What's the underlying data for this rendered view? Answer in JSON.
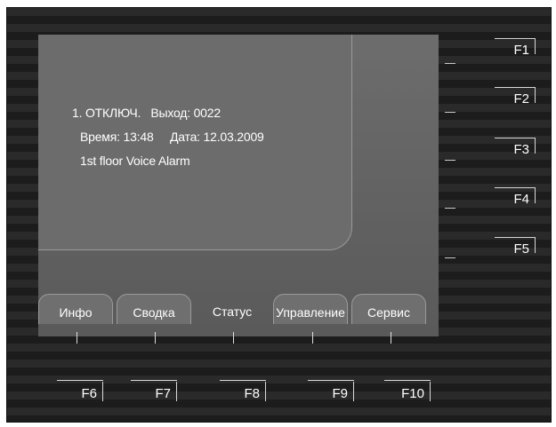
{
  "event": {
    "line1": "1. ОТКЛЮЧ.   Выход: 0022",
    "line2": "Время: 13:48     Дата: 12.03.2009",
    "line3": "1st floor Voice Alarm"
  },
  "right_keys": [
    "F1",
    "F2",
    "F3",
    "F4",
    "F5"
  ],
  "tabs": [
    {
      "label": "Инфо",
      "active": false
    },
    {
      "label": "Сводка",
      "active": false
    },
    {
      "label": "Статус",
      "active": true
    },
    {
      "label": "Управление",
      "active": false
    },
    {
      "label": "Сервис",
      "active": false
    }
  ],
  "bottom_keys": [
    "F6",
    "F7",
    "F8",
    "F9",
    "F10"
  ],
  "colors": {
    "panel_background": "#6c6c6c",
    "frame_background": "#222222",
    "text": "#ffffff"
  }
}
